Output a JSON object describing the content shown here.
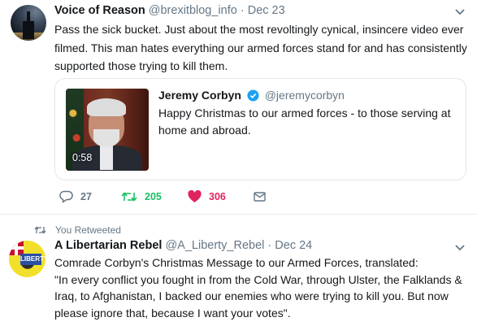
{
  "colors": {
    "accent_blue": "#1da1f2",
    "retweet_green": "#17bf63",
    "like_red": "#e0245e",
    "muted": "#657786"
  },
  "tweet1": {
    "display_name": "Voice of Reason",
    "handle": "@brexitblog_info",
    "separator": "·",
    "date": "Dec 23",
    "text": "Pass the sick bucket. Just about the most revoltingly cynical, insincere video ever filmed. This man hates everything our armed forces stand for and has consistently supported those trying to kill them.",
    "quoted": {
      "display_name": "Jeremy Corbyn",
      "handle": "@jeremycorbyn",
      "text": "Happy Christmas to our armed forces - to those serving at home and abroad.",
      "video_duration": "0:58"
    },
    "actions": {
      "replies": "27",
      "retweets": "205",
      "likes": "306",
      "icons": [
        "reply-icon",
        "retweet-icon",
        "heart-icon",
        "message-icon"
      ]
    }
  },
  "retweet_context": {
    "label": "You Retweeted"
  },
  "tweet2": {
    "display_name": "A Libertarian Rebel",
    "handle": "@A_Liberty_Rebel",
    "separator": "·",
    "date": "Dec 24",
    "line1": "Comrade Corbyn's Christmas Message to our Armed Forces, translated:",
    "line2": "\"In every conflict you fought in from the Cold War, through Ulster, the Falklands & Iraq, to Afghanistan, I backed our enemies who were trying to kill you. But now please ignore that, because I want your votes\".",
    "avatar_tag": "LIBERTY"
  }
}
